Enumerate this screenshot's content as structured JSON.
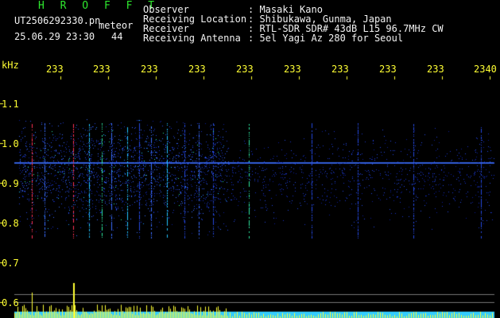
{
  "header": {
    "app_name": "H R O F F T",
    "filename": "UT2506292330.pn",
    "event_label": "meteor",
    "datetime": "25.06.29 23:30",
    "count": "44",
    "info_labels": [
      "Observer",
      "Receiving Location",
      "Receiver",
      "Receiving Antenna"
    ],
    "info_values": [
      ": Masaki Kano",
      ": Shibukawa, Gunma, Japan",
      ": RTL-SDR SDR# 43dB L15 96.7MHz CW",
      ": 5el Yagi Az 280 for Seoul"
    ]
  },
  "x_axis": {
    "ticks": [
      "233",
      "233",
      "233",
      "233",
      "233",
      "233",
      "233",
      "233",
      "233",
      "2340"
    ]
  },
  "y_axis": {
    "unit": "kHz",
    "ticks": [
      "1.1",
      "1.0",
      "0.9",
      "0.8",
      "0.7",
      "0.6"
    ]
  },
  "colors": {
    "background": "#000000",
    "text": "#f2f2f2",
    "title": "#2ee82e",
    "axis": "#ffff33",
    "signal_low": "#1a33c8",
    "signal_high": "#ff3333",
    "histogram": "#ffff33",
    "baseline": "#33ccff"
  }
}
